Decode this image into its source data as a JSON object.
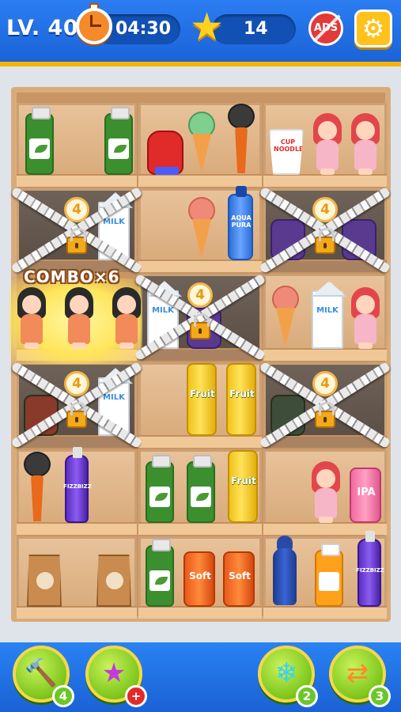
{
  "hud": {
    "level": "LV. 40",
    "timer": "04:30",
    "stars": "14",
    "ads_label": "ADS",
    "settings_icon": "gear-icon"
  },
  "board": {
    "combo_text": "COMBO×6",
    "lock_counts": [
      "4",
      "4",
      "4",
      "4",
      "4"
    ],
    "labels": {
      "cup_noodle": "CUP NOODLE",
      "milk": "MILK",
      "aqua": "AQUA PURA",
      "fruit": "Fruit",
      "fizz": "FIZZBIZZ",
      "soft": "Soft",
      "ipa": "IPA"
    }
  },
  "boosters": {
    "hammer": {
      "icon": "hammer-icon",
      "count": "4"
    },
    "magic": {
      "icon": "magic-star-icon",
      "count": "+"
    },
    "freeze": {
      "icon": "snowflake-icon",
      "count": "2"
    },
    "shuffle": {
      "icon": "shuffle-icon",
      "count": "3"
    }
  },
  "colors": {
    "topbar": "#2c7df2",
    "accent_gold": "#f5b400",
    "shelf_wood": "#d9ab7a",
    "booster_green": "#7cc61c"
  }
}
